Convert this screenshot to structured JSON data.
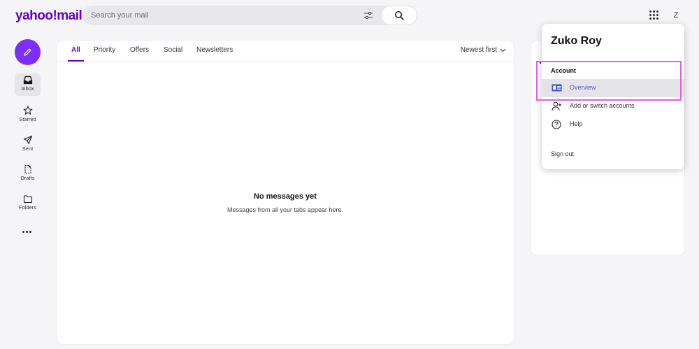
{
  "header": {
    "logo": "yahoo!mail",
    "search_placeholder": "Search your mail",
    "avatar_initial": "Z"
  },
  "nav": {
    "items": [
      {
        "label": "Inbox",
        "icon": "inbox-icon",
        "active": true
      },
      {
        "label": "Starred",
        "icon": "star-icon"
      },
      {
        "label": "Sent",
        "icon": "send-icon"
      },
      {
        "label": "Drafts",
        "icon": "draft-icon"
      },
      {
        "label": "Folders",
        "icon": "folder-icon"
      }
    ]
  },
  "main": {
    "tabs": [
      "All",
      "Priority",
      "Offers",
      "Social",
      "Newsletters"
    ],
    "sort": "Newest first",
    "empty_title": "No messages yet",
    "empty_subtitle": "Messages from all your tabs appear here."
  },
  "account_menu": {
    "name": "Zuko Roy",
    "section": "Account",
    "items": [
      "Overview",
      "Add or switch accounts",
      "Help"
    ],
    "sign_out": "Sign out"
  },
  "colors": {
    "brand": "#6001d2",
    "compose": "#7d2eff",
    "highlight": "#e85be8"
  }
}
